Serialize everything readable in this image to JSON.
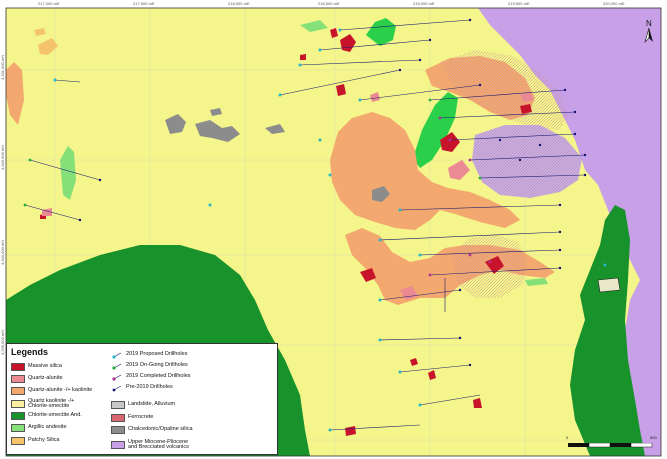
{
  "coordinates": {
    "top": [
      "217,000 mE",
      "217,500 mE",
      "218,000 mE",
      "218,500 mE",
      "219,000 mE",
      "219,500 mE",
      "220,000 mE"
    ],
    "left": [
      "4,341,000 mN",
      "4,340,500 mN",
      "4,340,000 mN",
      "4,339,500 mN"
    ]
  },
  "north_arrow": {
    "label": "N",
    "icon": "north-arrow-icon"
  },
  "scale_bar": {
    "start": "0",
    "end": "500"
  },
  "legend": {
    "title": "Legends",
    "items": [
      {
        "label": "Massive silica",
        "color": "#c8142a"
      },
      {
        "label": "Quartz-alunite",
        "color": "#ec8a94"
      },
      {
        "label": "Quartz-alunite -/+ kaolinite",
        "color": "#f3a870"
      },
      {
        "label": "Quartz kaolinite -/+\nChlorite-smectite",
        "color": "#fbf0a0"
      },
      {
        "label": "Chlorite-smectite And.",
        "color": "#18922a"
      },
      {
        "label": "Argillic andesite",
        "color": "#86e07a"
      },
      {
        "label": "Patchy Silica",
        "color": "#f5c46a"
      }
    ],
    "items_right": [
      {
        "label": "2019 Proposed Drillholes",
        "color": "#2ab8c8",
        "symbol": "cyan-drillhole-icon"
      },
      {
        "label": "2019 On-Going Drillholes",
        "color": "#20b040",
        "symbol": "green-drillhole-icon"
      },
      {
        "label": "2019 Completed Drillholes",
        "color": "#b03098",
        "symbol": "magenta-drillhole-icon"
      },
      {
        "label": "Pre-2019 Drillholes",
        "color": "#101070",
        "symbol": "navy-drillhole-icon"
      },
      {
        "label": "Landslide, Alluvium",
        "color": "#c8c8c8"
      },
      {
        "label": "Ferrocrete",
        "color": "#d86870"
      },
      {
        "label": "Chalcedonic/Opaline silica",
        "color": "#8c8c8c"
      },
      {
        "label": "Upper Miocene-Pliocene\nand Brecciated volcanics",
        "color": "#c8a0e8"
      }
    ]
  },
  "colors": {
    "background": "#f4f58a",
    "volcanics": "#c8a0e8",
    "chlorite": "#18922a",
    "argillic": "#86e07a",
    "quartz_alunite_kaolinite": "#f3a870",
    "massive_silica": "#c8142a",
    "chalcedonic": "#8c8c8c",
    "grid": "#d8d8b8"
  }
}
